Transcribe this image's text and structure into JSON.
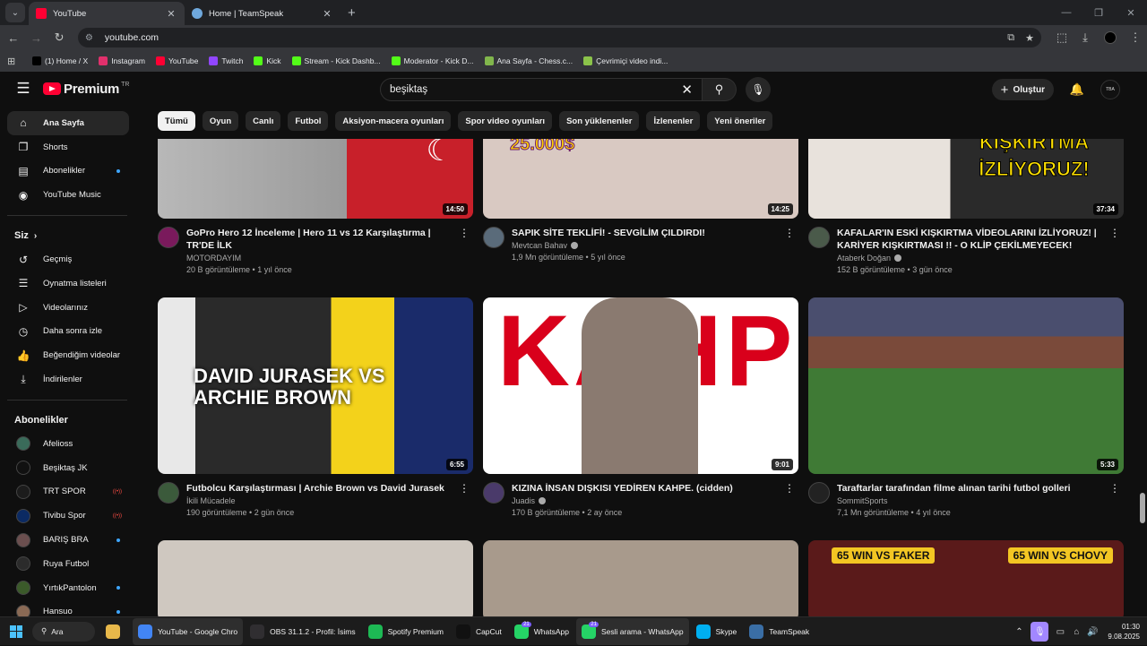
{
  "browser": {
    "tabs": [
      {
        "title": "YouTube",
        "active": true,
        "close": "✕"
      },
      {
        "title": "Home | TeamSpeak",
        "active": false,
        "close": "✕"
      }
    ],
    "new_tab": "+",
    "url": "youtube.com",
    "bookmarks": [
      {
        "label": "(1) Home / X",
        "color": "#000000"
      },
      {
        "label": "Instagram",
        "color": "#e1306c"
      },
      {
        "label": "YouTube",
        "color": "#ff0033"
      },
      {
        "label": "Twitch",
        "color": "#9146ff"
      },
      {
        "label": "Kick",
        "color": "#53fc18"
      },
      {
        "label": "Stream - Kick Dashb...",
        "color": "#53fc18"
      },
      {
        "label": "Moderator - Kick D...",
        "color": "#53fc18"
      },
      {
        "label": "Ana Sayfa - Chess.c...",
        "color": "#81b64c"
      },
      {
        "label": "Çevrimiçi video indi...",
        "color": "#8bc34a"
      }
    ]
  },
  "header": {
    "logo_text": "Premium",
    "logo_sup": "TR",
    "search_query": "beşiktaş",
    "create_label": "Oluştur",
    "avatar_text": "TBA"
  },
  "sidebar": {
    "main": [
      {
        "label": "Ana Sayfa",
        "icon": "home-icon",
        "glyph": "⌂",
        "active": true
      },
      {
        "label": "Shorts",
        "icon": "shorts-icon",
        "glyph": "❐",
        "active": false
      },
      {
        "label": "Abonelikler",
        "icon": "subscriptions-icon",
        "glyph": "▤",
        "active": false,
        "dot": true
      },
      {
        "label": "YouTube Music",
        "icon": "music-icon",
        "glyph": "◉",
        "active": false
      }
    ],
    "you_heading": "Siz",
    "you_items": [
      {
        "label": "Geçmiş",
        "icon": "history-icon",
        "glyph": "↺"
      },
      {
        "label": "Oynatma listeleri",
        "icon": "playlists-icon",
        "glyph": "☰"
      },
      {
        "label": "Videolarınız",
        "icon": "your-videos-icon",
        "glyph": "▷"
      },
      {
        "label": "Daha sonra izle",
        "icon": "watch-later-icon",
        "glyph": "◷"
      },
      {
        "label": "Beğendiğim videolar",
        "icon": "like-icon",
        "glyph": "👍"
      },
      {
        "label": "İndirilenler",
        "icon": "download-icon",
        "glyph": "⤓"
      }
    ],
    "subs_heading": "Abonelikler",
    "subs": [
      {
        "label": "Afelioss",
        "color": "#3a6b5a",
        "marker": ""
      },
      {
        "label": "Beşiktaş JK",
        "color": "#111111",
        "marker": ""
      },
      {
        "label": "TRT SPOR",
        "color": "#1c1c1c",
        "marker": "live"
      },
      {
        "label": "Tivibu Spor",
        "color": "#0b2a63",
        "marker": "live"
      },
      {
        "label": "BARIŞ BRA",
        "color": "#6b4f4f",
        "marker": "dot"
      },
      {
        "label": "Ruya Futbol",
        "color": "#2b2b2b",
        "marker": ""
      },
      {
        "label": "YırtıkPantolon",
        "color": "#3b5a2a",
        "marker": "dot"
      },
      {
        "label": "Hansuo",
        "color": "#8a6a55",
        "marker": "dot"
      }
    ],
    "live_text": "((•))"
  },
  "chips": [
    "Tümü",
    "Oyun",
    "Canlı",
    "Futbol",
    "Aksiyon-macera oyunları",
    "Spor video oyunları",
    "Son yüklenenler",
    "İzlenenler",
    "Yeni öneriler"
  ],
  "videos": [
    {
      "title": "GoPro Hero 12 İnceleme | Hero 11 vs 12 Karşılaştırma | TR'DE İLK",
      "channel": "MOTORDAYIM",
      "verified": false,
      "stats": "20 B görüntüleme • 1 yıl önce",
      "duration": "14:50",
      "thumb_color": "#c8202a",
      "avatar_color": "#7a1a5c"
    },
    {
      "title": "SAPIK SİTE TEKLİFİ! - SEVGİLİM ÇILDIRDI!",
      "channel": "Mevtcan Bahav",
      "verified": true,
      "stats": "1,9 Mn görüntüleme • 5 yıl önce",
      "duration": "14:25",
      "thumb_color": "#d9c9c2",
      "avatar_color": "#5a6b7a",
      "overlay": "25.000$"
    },
    {
      "title": "KAFALAR'IN ESKİ KIŞKIRTMA VİDEOLARINI İZLİYORUZ! | KARİYER KIŞKIRTMASI !! - O KLİP ÇEKİLMEYECEK!",
      "channel": "Ataberk Doğan",
      "verified": true,
      "stats": "152 B görüntüleme • 3 gün önce",
      "duration": "37:34",
      "thumb_color": "#1a1a1a",
      "avatar_color": "#4a5a4a",
      "overlay": "KAFALAR KIŞKIRTMA İZLİYORUZ!"
    },
    {
      "title": "Futbolcu Karşılaştırması | Archie Brown vs David Jurasek",
      "channel": "İkili Mücadele",
      "verified": false,
      "stats": "190 görüntüleme • 2 gün önce",
      "duration": "6:55",
      "thumb_color": "#202020",
      "avatar_color": "#3b5a3b",
      "overlay": "DAVID JURASEK VS ARCHIE BROWN"
    },
    {
      "title": "KIZINA İNSAN DIŞKISI YEDİREN KAHPE. (cidden)",
      "channel": "Juadis",
      "verified": true,
      "stats": "170 B görüntüleme • 2 ay önce",
      "duration": "9:01",
      "thumb_color": "#ffffff",
      "avatar_color": "#4a3a6a",
      "overlay": "KAHPE"
    },
    {
      "title": "Taraftarlar tarafından filme alınan tarihi futbol golleri",
      "channel": "SommitSports",
      "verified": false,
      "stats": "7,1 Mn görüntüleme • 4 yıl önce",
      "duration": "5:33",
      "thumb_color": "#3f7a35",
      "avatar_color": "#222222"
    },
    {
      "title": "",
      "channel": "",
      "stats": "",
      "duration": "",
      "thumb_color": "#cfc8c0"
    },
    {
      "title": "",
      "channel": "",
      "stats": "",
      "duration": "",
      "thumb_color": "#a89a8c"
    },
    {
      "title": "",
      "channel": "",
      "stats": "",
      "duration": "",
      "thumb_color": "#5a1a1a",
      "overlay_left": "65 WIN VS FAKER",
      "overlay_right": "65 WIN VS CHOVY"
    }
  ],
  "taskbar": {
    "search": "Ara",
    "apps": [
      {
        "label": "",
        "color": "#e8b84a",
        "active": false,
        "badge": ""
      },
      {
        "label": "YouTube - Google Chro",
        "color": "#4285f4",
        "active": true,
        "badge": ""
      },
      {
        "label": "OBS 31.1.2 - Profil: İsims",
        "color": "#302e31",
        "active": false,
        "badge": ""
      },
      {
        "label": "Spotify Premium",
        "color": "#1db954",
        "active": false,
        "badge": ""
      },
      {
        "label": "CapCut",
        "color": "#111111",
        "active": false,
        "badge": ""
      },
      {
        "label": "WhatsApp",
        "color": "#25d366",
        "active": false,
        "badge": "21"
      },
      {
        "label": "Sesli arama - WhatsApp",
        "color": "#25d366",
        "active": true,
        "badge": "21"
      },
      {
        "label": "Skype",
        "color": "#00aff0",
        "active": false,
        "badge": ""
      },
      {
        "label": "TeamSpeak",
        "color": "#3a6ea5",
        "active": false,
        "badge": ""
      }
    ],
    "time": "01:30",
    "date": "9.08.2025"
  }
}
